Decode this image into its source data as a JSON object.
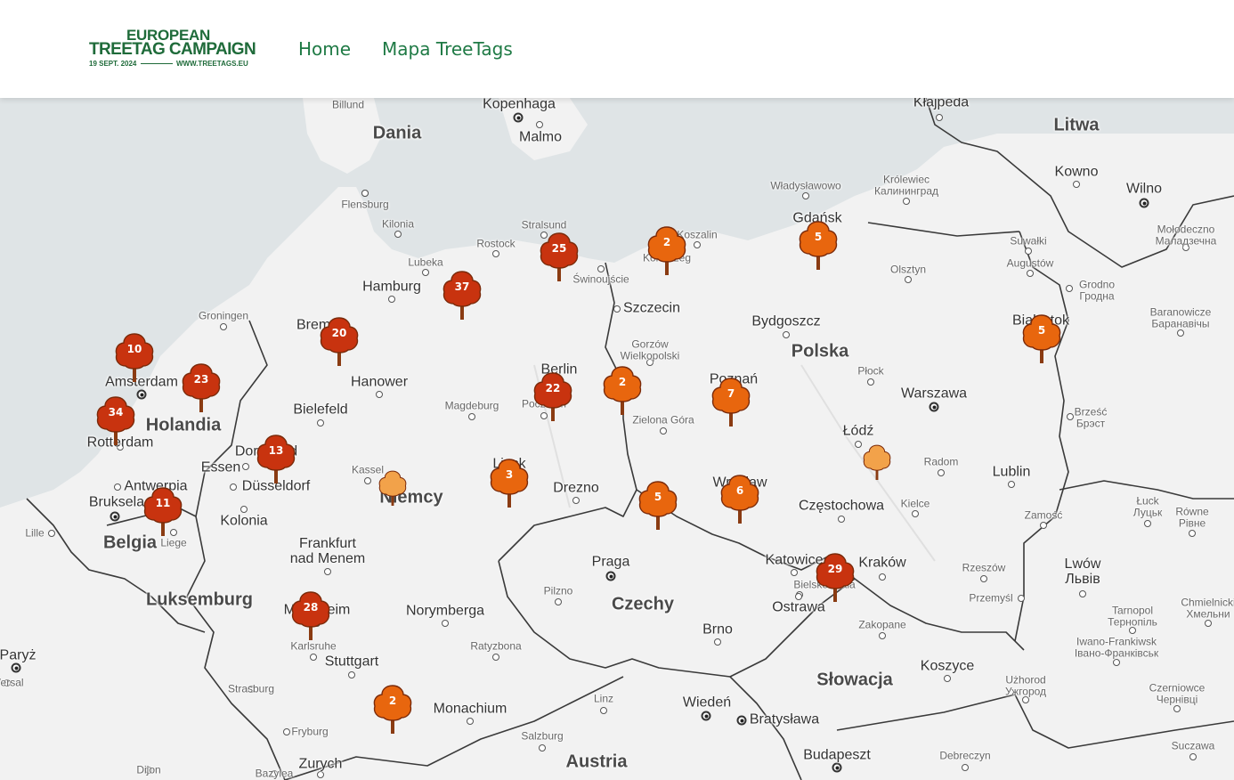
{
  "header": {
    "logo": {
      "line1": "EUROPEAN",
      "line2": "TREETAG CAMPAIGN",
      "date": "19 SEPT. 2024",
      "url": "WWW.TREETAGS.EU"
    },
    "nav": [
      {
        "label": "Home"
      },
      {
        "label": "Mapa TreeTags"
      }
    ]
  },
  "colors": {
    "brand": "#1f6b3a",
    "nav": "#1f7a45",
    "sea": "#dfe4e6",
    "land": "#f2f2f2",
    "marker_dark": "#c8330f",
    "marker_mid": "#e8660e",
    "marker_light": "#f2a24a"
  },
  "countries": [
    "Dania",
    "Litwa",
    "Polska",
    "Holandia",
    "Niemcy",
    "Belgia",
    "Luksemburg",
    "Czechy",
    "Słowacja",
    "Austria"
  ],
  "places": [
    {
      "name": "Billund"
    },
    {
      "name": "Kopenhaga"
    },
    {
      "name": "Malmo"
    },
    {
      "name": "Kłajpeda"
    },
    {
      "name": "Flensburg"
    },
    {
      "name": "Kilonia"
    },
    {
      "name": "Stralsund"
    },
    {
      "name": "Rostock"
    },
    {
      "name": "Lubeka"
    },
    {
      "name": "Hamburg"
    },
    {
      "name": "Świnoujście"
    },
    {
      "name": "Szczecin"
    },
    {
      "name": "Koszalin"
    },
    {
      "name": "Kołobrzeg"
    },
    {
      "name": "Gdańsk"
    },
    {
      "name": "Władysławowo"
    },
    {
      "name": "Królewiec\nКалининград"
    },
    {
      "name": "Kowno"
    },
    {
      "name": "Wilno"
    },
    {
      "name": "Olsztyn"
    },
    {
      "name": "Suwałki"
    },
    {
      "name": "Augustów"
    },
    {
      "name": "Grodno\nГродна"
    },
    {
      "name": "Mołodeczno\nМаладзечна"
    },
    {
      "name": "Baranowicze\nБаранавічы"
    },
    {
      "name": "Białystok"
    },
    {
      "name": "Groningen"
    },
    {
      "name": "Bremen"
    },
    {
      "name": "Amsterdam"
    },
    {
      "name": "Hanower"
    },
    {
      "name": "Bielefeld"
    },
    {
      "name": "Magdeburg"
    },
    {
      "name": "Berlin"
    },
    {
      "name": "Poczdam"
    },
    {
      "name": "Gorzów\nWielkopolski"
    },
    {
      "name": "Bydgoszcz"
    },
    {
      "name": "Poznań"
    },
    {
      "name": "Płock"
    },
    {
      "name": "Warszawa"
    },
    {
      "name": "Zielona Góra"
    },
    {
      "name": "Łódź"
    },
    {
      "name": "Radom"
    },
    {
      "name": "Lublin"
    },
    {
      "name": "Brześć\nБрэст"
    },
    {
      "name": "Rotterdam"
    },
    {
      "name": "Dortmund"
    },
    {
      "name": "Essen"
    },
    {
      "name": "Düsseldorf"
    },
    {
      "name": "Kassel"
    },
    {
      "name": "Lipsk"
    },
    {
      "name": "Drezno"
    },
    {
      "name": "Wrocław"
    },
    {
      "name": "Częstochowa"
    },
    {
      "name": "Kielce"
    },
    {
      "name": "Antwerpia"
    },
    {
      "name": "Bruksela"
    },
    {
      "name": "Kolonia"
    },
    {
      "name": "Lille"
    },
    {
      "name": "Liege"
    },
    {
      "name": "Zamość"
    },
    {
      "name": "Łuck\nЛуцьк"
    },
    {
      "name": "Równe\nРівне"
    },
    {
      "name": "Frankfurt\nnad Menem"
    },
    {
      "name": "Praga"
    },
    {
      "name": "Katowice"
    },
    {
      "name": "Kraków"
    },
    {
      "name": "Bielsko-Biała"
    },
    {
      "name": "Rzeszów"
    },
    {
      "name": "Lwów\nЛьвів"
    },
    {
      "name": "Pilzno"
    },
    {
      "name": "Ostrawa"
    },
    {
      "name": "Przemyśl"
    },
    {
      "name": "Mannheim"
    },
    {
      "name": "Norymberga"
    },
    {
      "name": "Brno"
    },
    {
      "name": "Tarnopol\nТернопіль"
    },
    {
      "name": "Chmielnicki\nХмельни"
    },
    {
      "name": "Karlsruhe"
    },
    {
      "name": "Stuttgart"
    },
    {
      "name": "Ratyzbona"
    },
    {
      "name": "Zakopane"
    },
    {
      "name": "Iwano-Frankiwsk\nІвано-Франківськ"
    },
    {
      "name": "Paryż"
    },
    {
      "name": "Wersal"
    },
    {
      "name": "Koszyce"
    },
    {
      "name": "Strasburg"
    },
    {
      "name": "Wiedeń"
    },
    {
      "name": "Użhorod\nУжгород"
    },
    {
      "name": "Czerniowce\nЧернівці"
    },
    {
      "name": "Linz"
    },
    {
      "name": "Bratysława"
    },
    {
      "name": "Monachium"
    },
    {
      "name": "Fryburg"
    },
    {
      "name": "Salzburg"
    },
    {
      "name": "Suczawa"
    },
    {
      "name": "Dijon"
    },
    {
      "name": "Zurych"
    },
    {
      "name": "Budapeszt"
    },
    {
      "name": "Debreczyn"
    },
    {
      "name": "Bazylea"
    }
  ],
  "markers": [
    {
      "count": "25",
      "tone": "dark"
    },
    {
      "count": "2",
      "tone": "mid"
    },
    {
      "count": "5",
      "tone": "mid"
    },
    {
      "count": "37",
      "tone": "dark"
    },
    {
      "count": "20",
      "tone": "dark"
    },
    {
      "count": "10",
      "tone": "dark"
    },
    {
      "count": "23",
      "tone": "dark"
    },
    {
      "count": "34",
      "tone": "dark"
    },
    {
      "count": "22",
      "tone": "dark"
    },
    {
      "count": "2",
      "tone": "mid"
    },
    {
      "count": "7",
      "tone": "mid"
    },
    {
      "count": "5",
      "tone": "mid"
    },
    {
      "count": "13",
      "tone": "dark"
    },
    {
      "count": "",
      "tone": "light"
    },
    {
      "count": "3",
      "tone": "mid"
    },
    {
      "count": "",
      "tone": "light"
    },
    {
      "count": "5",
      "tone": "mid"
    },
    {
      "count": "6",
      "tone": "mid"
    },
    {
      "count": "11",
      "tone": "dark"
    },
    {
      "count": "29",
      "tone": "dark"
    },
    {
      "count": "28",
      "tone": "dark"
    },
    {
      "count": "2",
      "tone": "mid"
    }
  ]
}
